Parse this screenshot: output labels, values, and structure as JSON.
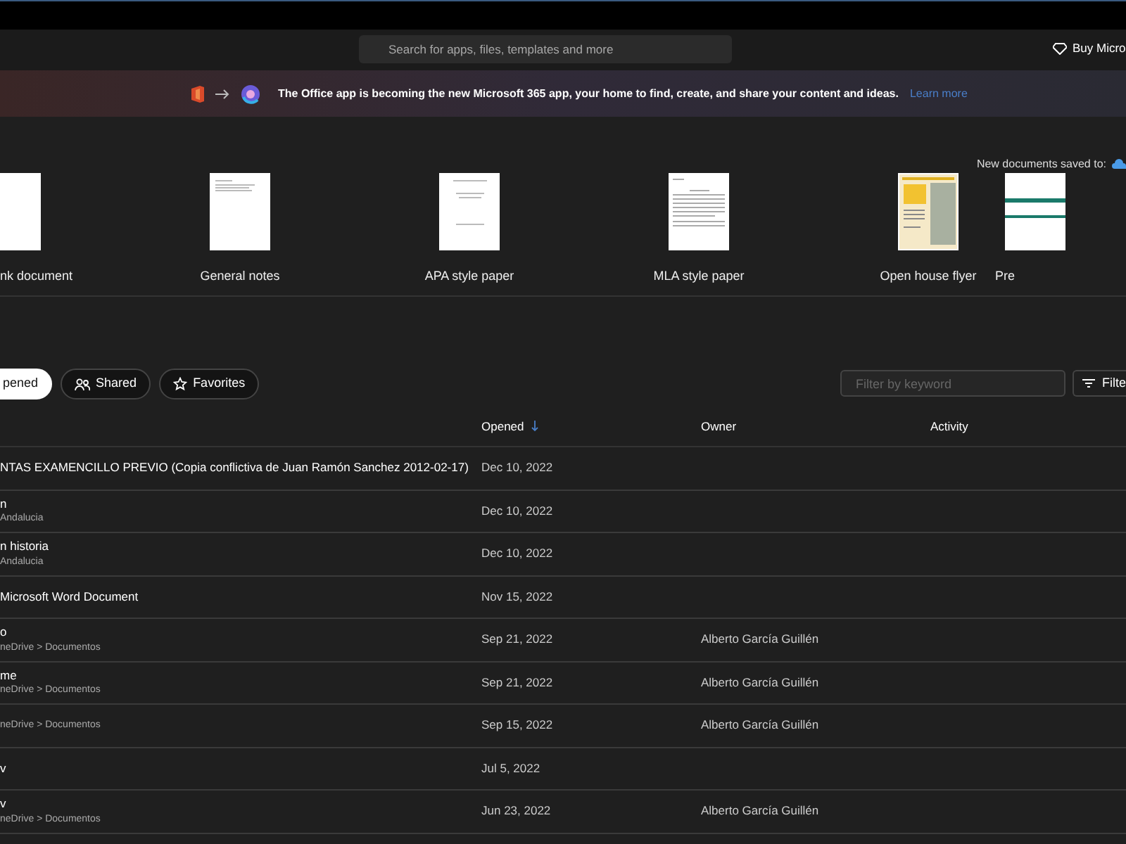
{
  "search": {
    "placeholder": "Search for apps, files, templates and more"
  },
  "buy_button": "Buy Micro",
  "banner": {
    "text": "The Office app is becoming the new Microsoft 365 app, your home to find, create, and share your content and ideas.",
    "link": "Learn more"
  },
  "save_location_label": "New documents saved to:",
  "templates": [
    {
      "label": "nk document",
      "kind": "blank"
    },
    {
      "label": "General notes",
      "kind": "notes"
    },
    {
      "label": "APA style paper",
      "kind": "apa"
    },
    {
      "label": "MLA style paper",
      "kind": "mla"
    },
    {
      "label": "Open house flyer",
      "kind": "flyer"
    },
    {
      "label": "Pre",
      "kind": "partial"
    }
  ],
  "tabs": [
    {
      "label": "pened",
      "selected": true
    },
    {
      "label": "Shared",
      "selected": false
    },
    {
      "label": "Favorites",
      "selected": false
    }
  ],
  "filter": {
    "placeholder": "Filter by keyword",
    "button": "Filte"
  },
  "table": {
    "columns": [
      "Opened",
      "Owner",
      "Activity"
    ],
    "rows": [
      {
        "name": "NTAS EXAMENCILLO PREVIO (Copia conflictiva de Juan Ramón Sanchez 2012-02-17)",
        "location": "",
        "opened": "Dec 10, 2022",
        "owner": ""
      },
      {
        "name": "n",
        "location": "Andalucia",
        "opened": "Dec 10, 2022",
        "owner": ""
      },
      {
        "name": "n historia",
        "location": "Andalucia",
        "opened": "Dec 10, 2022",
        "owner": ""
      },
      {
        "name": "Microsoft Word Document",
        "location": "",
        "opened": "Nov 15, 2022",
        "owner": ""
      },
      {
        "name": "o",
        "location": "neDrive > Documentos",
        "opened": "Sep 21, 2022",
        "owner": "Alberto García Guillén"
      },
      {
        "name": "me",
        "location": "neDrive > Documentos",
        "opened": "Sep 21, 2022",
        "owner": "Alberto García Guillén"
      },
      {
        "name": "",
        "location": "neDrive > Documentos",
        "opened": "Sep 15, 2022",
        "owner": "Alberto García Guillén"
      },
      {
        "name": "v",
        "location": "",
        "opened": "Jul 5, 2022",
        "owner": ""
      },
      {
        "name": "v",
        "location": "neDrive > Documentos",
        "opened": "Jun 23, 2022",
        "owner": "Alberto García Guillén"
      }
    ]
  }
}
